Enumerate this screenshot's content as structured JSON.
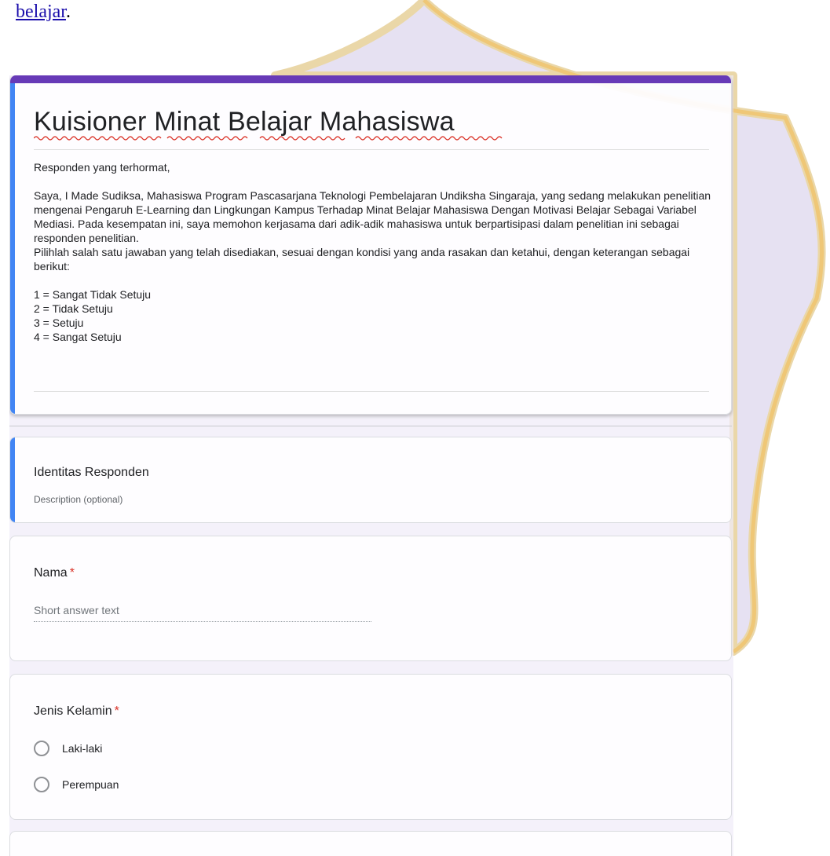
{
  "document": {
    "link_text": "belajar",
    "trailing_text": "."
  },
  "form": {
    "title": "Kuisioner Minat Belajar Mahasiswa",
    "description": {
      "greeting": "Responden yang terhormat,",
      "paragraph_1": "Saya, I Made Sudiksa, Mahasiswa Program Pascasarjana Teknologi Pembelajaran Undiksha Singaraja, yang sedang melakukan penelitian mengenai Pengaruh E-Learning dan Lingkungan Kampus Terhadap Minat Belajar Mahasiswa Dengan Motivasi Belajar Sebagai Variabel Mediasi. Pada kesempatan ini, saya memohon kerjasama dari adik-adik mahasiswa untuk berpartisipasi dalam penelitian ini sebagai responden penelitian.",
      "paragraph_2": "Pilihlah salah satu jawaban yang telah disediakan, sesuai dengan kondisi yang anda rasakan dan ketahui, dengan keterangan sebagai berikut:",
      "scale": [
        "1 = Sangat Tidak Setuju",
        "2 = Tidak Setuju",
        "3 = Setuju",
        "4 = Sangat Setuju"
      ]
    },
    "colors": {
      "theme": "#673ab7",
      "accent": "#4285f4",
      "required": "#d93025"
    }
  },
  "section": {
    "title": "Identitas Responden",
    "description_placeholder": "Description (optional)"
  },
  "questions": [
    {
      "title": "Nama",
      "required_mark": "*",
      "answer_placeholder": "Short answer text"
    },
    {
      "title": "Jenis Kelamin",
      "required_mark": "*",
      "options": [
        "Laki-laki",
        "Perempuan"
      ]
    }
  ]
}
